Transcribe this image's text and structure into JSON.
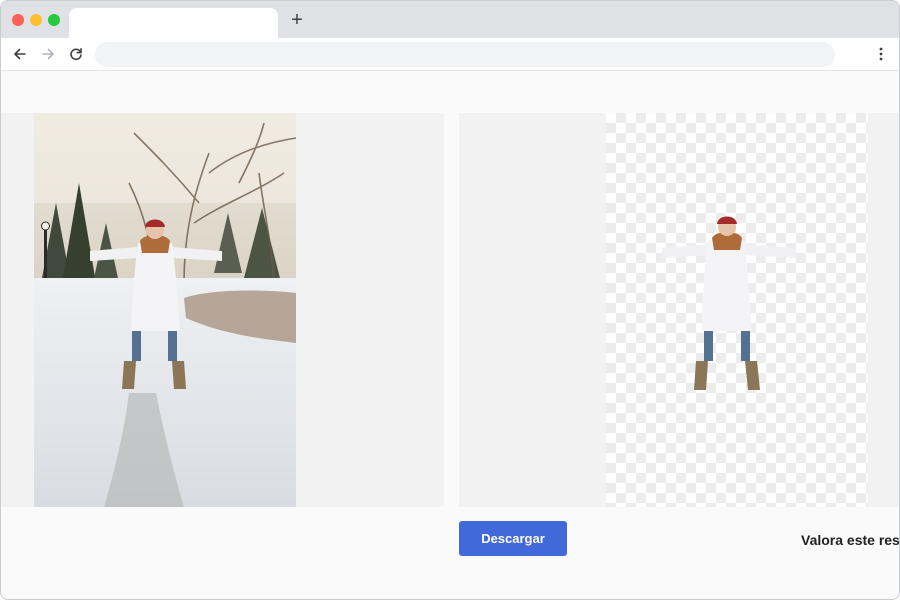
{
  "browser": {
    "tab_title": "",
    "new_tab_symbol": "+",
    "address_value": "",
    "icons": {
      "back": "arrow-left-icon",
      "forward": "arrow-right-icon",
      "reload": "reload-icon",
      "menu": "kebab-menu-icon"
    }
  },
  "main": {
    "original_image_alt": "",
    "result_image_alt": "",
    "download_label": "Descargar",
    "rating_prompt": "Valora este res"
  },
  "colors": {
    "accent": "#4169d9",
    "traffic_red": "#fe5f57",
    "traffic_yellow": "#febc2e",
    "traffic_green": "#28c840"
  }
}
